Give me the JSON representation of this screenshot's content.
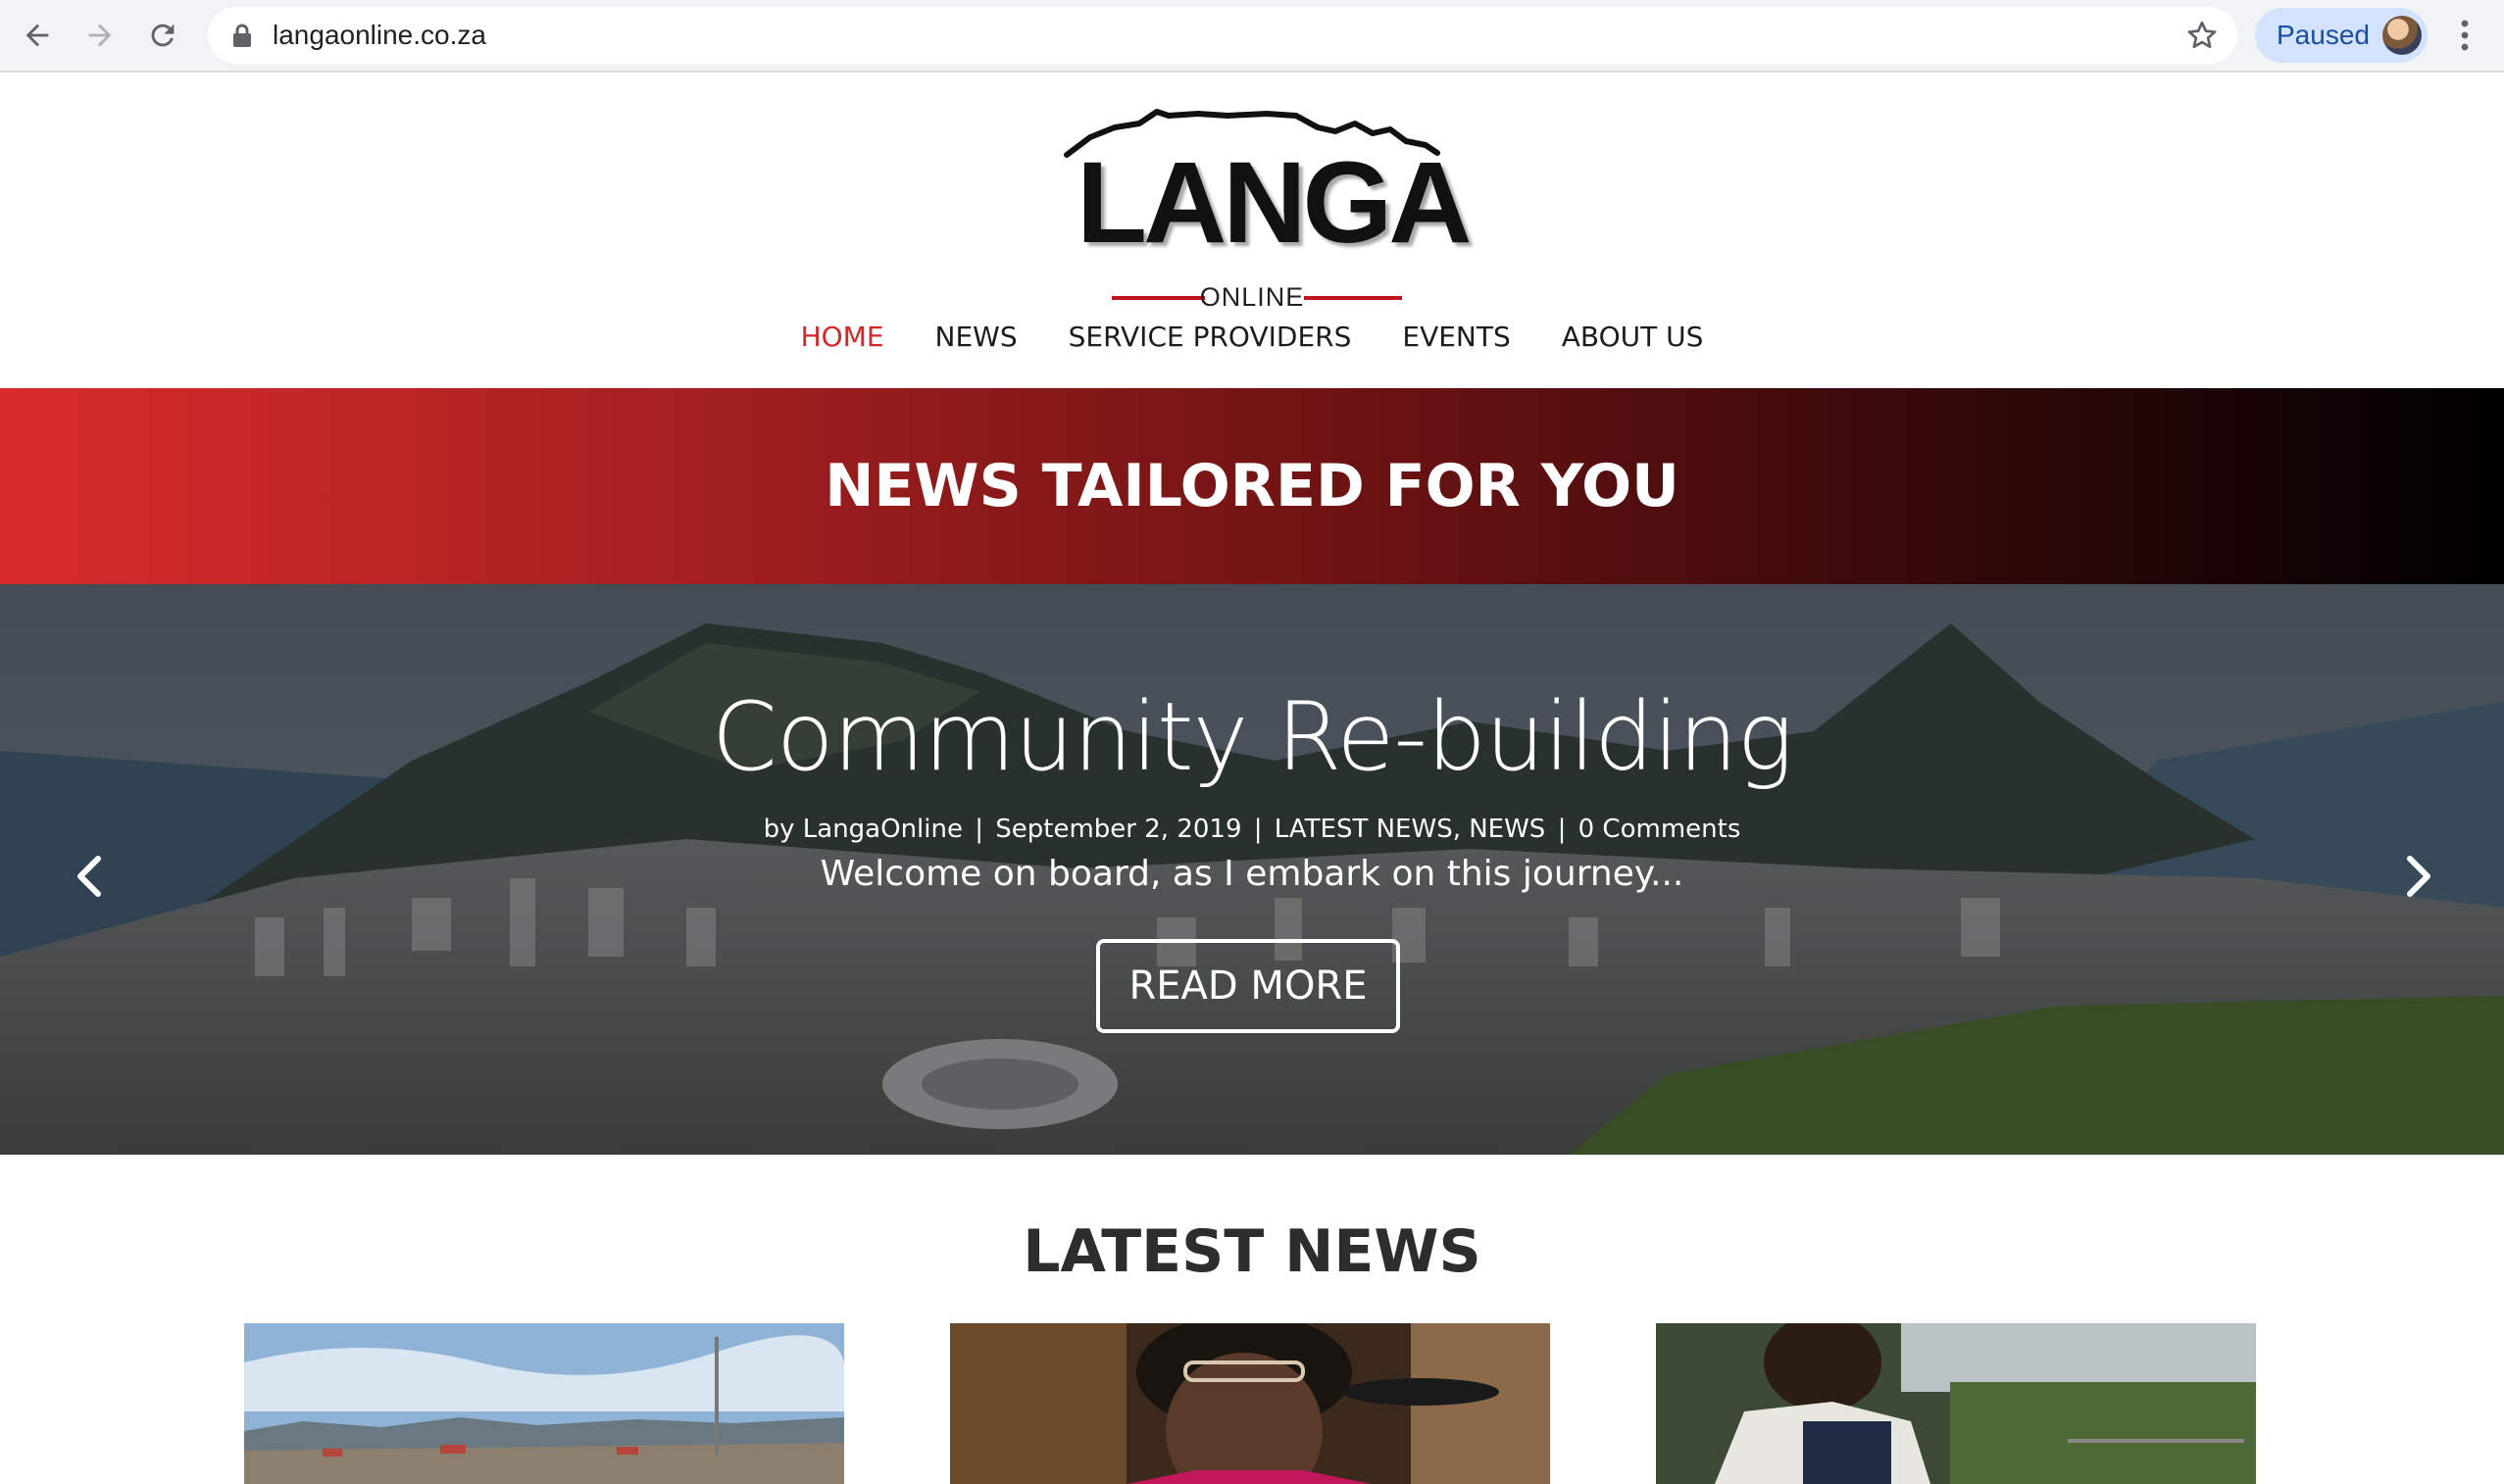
{
  "browser": {
    "url": "langaonline.co.za",
    "profile_label": "Paused",
    "icons": [
      "back-arrow-icon",
      "forward-arrow-icon",
      "reload-icon",
      "lock-icon",
      "star-icon",
      "avatar",
      "more-vert-icon"
    ]
  },
  "site": {
    "logo": {
      "wordmark": "LANGA",
      "subtitle": "ONLINE"
    },
    "nav": [
      {
        "label": "HOME",
        "active": true
      },
      {
        "label": "NEWS",
        "active": false
      },
      {
        "label": "SERVICE PROVIDERS",
        "active": false
      },
      {
        "label": "EVENTS",
        "active": false
      },
      {
        "label": "ABOUT US",
        "active": false
      }
    ],
    "accent_color": "#d7252a"
  },
  "banner": {
    "title": "NEWS TAILORED FOR YOU",
    "gradient": [
      "#d92b2b",
      "#000000"
    ]
  },
  "hero": {
    "title": "Community Re-building",
    "meta": {
      "by": "by LangaOnline",
      "sep1": "|",
      "date": "September 2, 2019",
      "sep2": "|",
      "categories": "LATEST NEWS, NEWS",
      "sep3": "|",
      "comments": "0 Comments"
    },
    "excerpt": "Welcome on board, as I embark on this journey...",
    "button_label": "READ MORE",
    "icons": [
      "chevron-left-icon",
      "chevron-right-icon"
    ]
  },
  "latest_news": {
    "title": "LATEST NEWS",
    "cards": [
      {
        "name": "news-card-1"
      },
      {
        "name": "news-card-2"
      },
      {
        "name": "news-card-3"
      }
    ]
  }
}
